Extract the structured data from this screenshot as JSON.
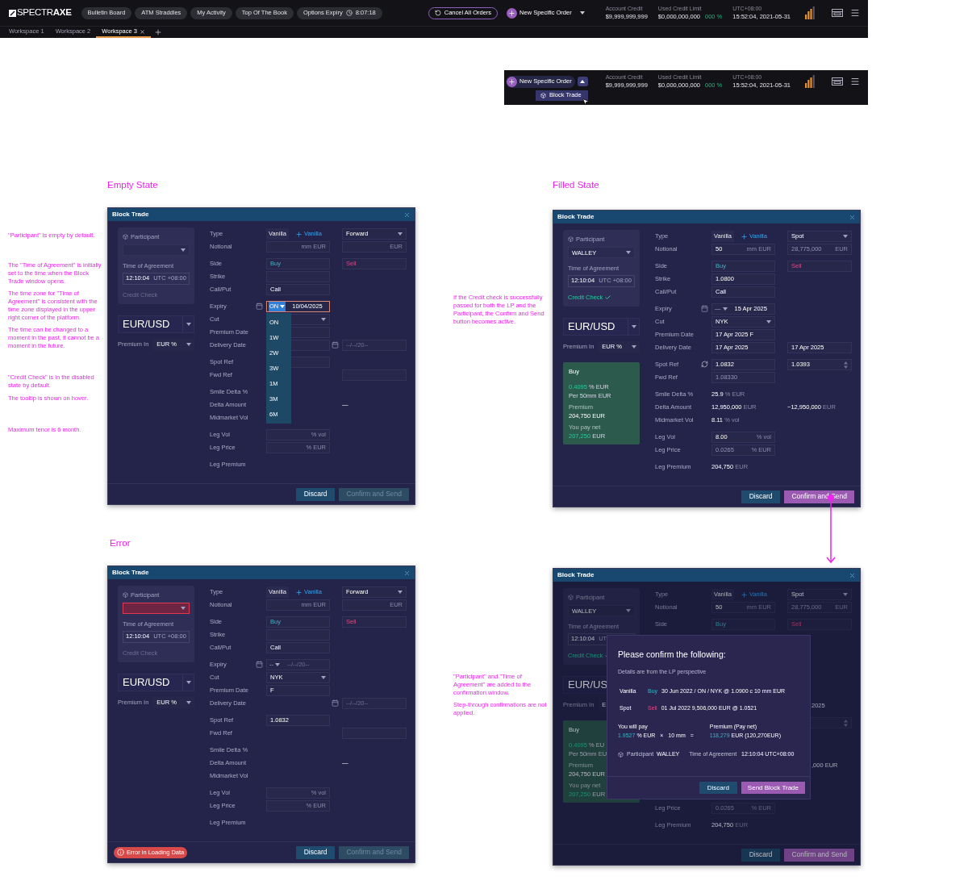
{
  "topbar": {
    "logo": "SPECTR**AXE**",
    "pills": [
      {
        "label": "Bulletin Board"
      },
      {
        "label": "ATM Straddles"
      },
      {
        "label": "My Activity"
      },
      {
        "label": "Top Of The Book"
      },
      {
        "label": "Options Expiry",
        "timer": "8:07:18"
      }
    ],
    "cancel": "Cancel All Orders",
    "order": {
      "label": "New Specific Order",
      "expanded": false
    },
    "credit": [
      {
        "label": "Account Credit",
        "value": "$9,999,999,999"
      },
      {
        "label": "Used Credit Limit",
        "value": "$0,000,000,000",
        "percent": "000 %"
      },
      {
        "label": "UTC+08:00",
        "value": "15:52:04, 2021-05-31"
      }
    ],
    "tabs": [
      {
        "label": "Workspace 1",
        "selected": false
      },
      {
        "label": "Workspace 2",
        "selected": false
      },
      {
        "label": "Workspace 3",
        "selected": true
      }
    ]
  },
  "menu_preview": {
    "order": {
      "label": "New Specific Order",
      "expanded": true,
      "items": [
        {
          "label": "Block Trade"
        }
      ]
    },
    "credit": [
      {
        "label": "Account Credit",
        "value": "$9,999,999,999"
      },
      {
        "label": "Used Credit Limit",
        "value": "$0,000,000,000",
        "percent": "000 %"
      },
      {
        "label": "UTC+08:00",
        "value": "15:52:04, 2021-05-31"
      }
    ]
  },
  "notes": {
    "empty": [
      "\"Participant\" is empty by default.",
      "The \"Time of Agreement\" is initially set to the time when the Block Trade window opens.",
      "The time zone for \"Time of Agreement\" is consistent with the time zone displayed in the upper right corner of the platform.",
      "The time can be changed to a moment in the past, it cannot be a moment in the future.",
      "\"Credit Check\" is in the disabled state by default.",
      "The tooltip is shown on hover.",
      "Maximum tenor is 6 month."
    ],
    "filled": [
      "If the Credit check is successfully passed for both the LP and the Participant, the Confirm and Send button becomes active."
    ],
    "confirm": [
      "\"Participant\" and \"Time of Agreement\" are added to the confirmation window.",
      "Step-through confirmations are not applied."
    ]
  },
  "sections": [
    {
      "heading": "Empty State",
      "window": {
        "title": "Block Trade",
        "participant": {
          "label": "Participant",
          "error": false
        },
        "agreement": {
          "label": "Time of Agreement",
          "time": "12:10:04",
          "zone": "UTC +08:00"
        },
        "credit_check": {
          "label": "Credit Check",
          "passed": false
        },
        "pair": "EUR/USD",
        "premium_in": {
          "label": "Premium In",
          "value": "EUR %"
        },
        "groups": [
          [
            {
              "kind": "row",
              "label": "Type",
              "near": {
                "kind": "type",
                "value": "Vanilla",
                "add": "Vanilla"
              },
              "far": {
                "kind": "select",
                "value": "Forward"
              }
            },
            {
              "kind": "row",
              "label": "Notional",
              "near": {
                "kind": "field",
                "unit": "mm EUR"
              },
              "far": {
                "kind": "field",
                "unit": "EUR"
              }
            }
          ],
          [
            {
              "kind": "row",
              "label": "Side",
              "near": {
                "kind": "buy",
                "value": "Buy"
              },
              "far": {
                "kind": "sell",
                "value": "Sell"
              }
            },
            {
              "kind": "row",
              "label": "Strike",
              "near": {
                "kind": "field"
              }
            },
            {
              "kind": "row",
              "label": "Call/Put",
              "near": {
                "kind": "field",
                "value": "Call"
              }
            }
          ],
          [
            {
              "kind": "row",
              "label": "Expiry",
              "near": {
                "kind": "expiry",
                "tenor": "ON",
                "date": "10/04/2025",
                "open": true,
                "options": [
                  "ON",
                  "1W",
                  "2W",
                  "3W",
                  "1M",
                  "3M",
                  "6M"
                ]
              }
            },
            {
              "kind": "row",
              "label": "Cut",
              "near": {
                "kind": "select"
              }
            },
            {
              "kind": "row",
              "label": "Premium Date",
              "near": {
                "kind": "field"
              }
            },
            {
              "kind": "row",
              "label": "Delivery Date",
              "near": {
                "kind": "field"
              },
              "far": {
                "kind": "datefield",
                "placeholder": "--/--/20--"
              }
            }
          ],
          [
            {
              "kind": "row",
              "label": "Spot Ref",
              "near": {
                "kind": "field"
              }
            },
            {
              "kind": "row",
              "label": "Fwd Ref",
              "far": {
                "kind": "field"
              }
            }
          ],
          [
            {
              "kind": "row",
              "label": "Smile Delta %"
            },
            {
              "kind": "row",
              "label": "Delta Amount",
              "far": {
                "kind": "text",
                "value": "—"
              }
            },
            {
              "kind": "row",
              "label": "Midmarket Vol"
            }
          ],
          [
            {
              "kind": "row",
              "label": "Leg Vol",
              "near": {
                "kind": "field",
                "unit": "% vol"
              }
            },
            {
              "kind": "row",
              "label": "Leg Price",
              "near": {
                "kind": "field",
                "unit": "% EUR"
              }
            }
          ],
          [
            {
              "kind": "row",
              "label": "Leg Premium"
            }
          ]
        ],
        "footer": {
          "discard": "Discard",
          "confirm": "Confirm and Send",
          "confirm_enabled": false
        }
      }
    },
    {
      "heading": "Filled State",
      "window": {
        "title": "Block Trade",
        "participant": {
          "label": "Participant",
          "value": "WALLEY",
          "error": false
        },
        "agreement": {
          "label": "Time of Agreement",
          "time": "12:10:04",
          "zone": "UTC +08:00"
        },
        "credit_check": {
          "label": "Credit Check",
          "passed": true
        },
        "pair": "EUR/USD",
        "premium_in": {
          "label": "Premium In",
          "value": "EUR %"
        },
        "summary": {
          "title": "Buy",
          "rate": "0.4095",
          "rate_unit": "% EUR",
          "per": "Per 50mm EUR",
          "premium_label": "Premium",
          "premium": "204,750 EUR",
          "net_label": "You pay net",
          "net": "207,250",
          "net_unit": "EUR"
        },
        "groups": [
          [
            {
              "kind": "row",
              "label": "Type",
              "near": {
                "kind": "type",
                "value": "Vanilla",
                "add": "Vanilla"
              },
              "far": {
                "kind": "select",
                "value": "Spot"
              }
            },
            {
              "kind": "row",
              "label": "Notional",
              "near": {
                "kind": "field",
                "value": "50",
                "unit": "mm EUR",
                "muted": false
              },
              "far": {
                "kind": "field",
                "value": "28,775,000",
                "unit": "EUR",
                "muted": true
              }
            }
          ],
          [
            {
              "kind": "row",
              "label": "Side",
              "near": {
                "kind": "buy",
                "value": "Buy"
              },
              "far": {
                "kind": "sell",
                "value": "Sell"
              }
            },
            {
              "kind": "row",
              "label": "Strike",
              "near": {
                "kind": "field",
                "value": "1.0800"
              }
            },
            {
              "kind": "row",
              "label": "Call/Put",
              "near": {
                "kind": "field",
                "value": "Call"
              }
            }
          ],
          [
            {
              "kind": "row",
              "label": "Expiry",
              "near": {
                "kind": "expiry",
                "tenor": "—",
                "date": "15 Apr 2025",
                "open": false
              }
            },
            {
              "kind": "row",
              "label": "Cut",
              "near": {
                "kind": "select",
                "value": "NYK"
              }
            },
            {
              "kind": "row",
              "label": "Premium Date",
              "near": {
                "kind": "field",
                "value": "17 Apr 2025 F"
              }
            },
            {
              "kind": "row",
              "label": "Delivery Date",
              "near": {
                "kind": "field",
                "value": "17 Apr 2025"
              },
              "far": {
                "kind": "field",
                "value": "17 Apr 2025"
              }
            }
          ],
          [
            {
              "kind": "row",
              "label": "Spot Ref",
              "near": {
                "kind": "reffield",
                "value": "1.0832"
              },
              "far": {
                "kind": "spin",
                "value": "1.0393"
              }
            },
            {
              "kind": "row",
              "label": "Fwd Ref",
              "near": {
                "kind": "field",
                "value": "1.08330",
                "muted": true
              }
            }
          ],
          [
            {
              "kind": "row",
              "label": "Smile Delta %",
              "near": {
                "kind": "text",
                "value": "25.9",
                "unit": "% EUR"
              }
            },
            {
              "kind": "row",
              "label": "Delta Amount",
              "near": {
                "kind": "text",
                "value": "12,950,000",
                "unit": "EUR"
              },
              "far": {
                "kind": "text",
                "value": "−12,950,000",
                "unit": "EUR"
              }
            },
            {
              "kind": "row",
              "label": "Midmarket Vol",
              "near": {
                "kind": "text",
                "value": "8.11",
                "unit": "% vol"
              }
            }
          ],
          [
            {
              "kind": "row",
              "label": "Leg Vol",
              "near": {
                "kind": "field",
                "value": "8.00",
                "unit": "% vol",
                "muted": false
              }
            },
            {
              "kind": "row",
              "label": "Leg Price",
              "near": {
                "kind": "field",
                "value": "0.0265",
                "unit": "% EUR",
                "muted": true
              }
            }
          ],
          [
            {
              "kind": "row",
              "label": "Leg Premium",
              "near": {
                "kind": "text",
                "value": "204,750",
                "unit": "EUR"
              }
            }
          ]
        ],
        "footer": {
          "discard": "Discard",
          "confirm": "Confirm and Send",
          "confirm_enabled": true
        }
      }
    },
    {
      "heading": "Error",
      "window": {
        "title": "Block Trade",
        "participant": {
          "label": "Participant",
          "error": true
        },
        "agreement": {
          "label": "Time of Agreement",
          "time": "12:10:04",
          "zone": "UTC +08:00"
        },
        "credit_check": {
          "label": "Credit Check",
          "passed": false
        },
        "pair": "EUR/USD",
        "premium_in": {
          "label": "Premium In",
          "value": "EUR %"
        },
        "groups": [
          [
            {
              "kind": "row",
              "label": "Type",
              "near": {
                "kind": "type",
                "value": "Vanilla",
                "add": "Vanilla"
              },
              "far": {
                "kind": "select",
                "value": "Forward"
              }
            },
            {
              "kind": "row",
              "label": "Notional",
              "near": {
                "kind": "field",
                "unit": "mm EUR"
              },
              "far": {
                "kind": "field",
                "unit": "EUR"
              }
            }
          ],
          [
            {
              "kind": "row",
              "label": "Side",
              "near": {
                "kind": "buy",
                "value": "Buy"
              },
              "far": {
                "kind": "sell",
                "value": "Sell"
              }
            },
            {
              "kind": "row",
              "label": "Strike",
              "near": {
                "kind": "field"
              }
            },
            {
              "kind": "row",
              "label": "Call/Put",
              "near": {
                "kind": "field",
                "value": "Call"
              }
            }
          ],
          [
            {
              "kind": "row",
              "label": "Expiry",
              "near": {
                "kind": "expiry",
                "tenor": "--",
                "placeholder": "--/--/20--",
                "open": false
              }
            },
            {
              "kind": "row",
              "label": "Cut",
              "near": {
                "kind": "select",
                "value": "NYK"
              }
            },
            {
              "kind": "row",
              "label": "Premium Date",
              "near": {
                "kind": "field",
                "value": "F"
              }
            },
            {
              "kind": "row",
              "label": "Delivery Date",
              "far": {
                "kind": "datefield",
                "placeholder": "--/--/20--"
              }
            }
          ],
          [
            {
              "kind": "row",
              "label": "Spot Ref",
              "near": {
                "kind": "field",
                "value": "1.0832"
              }
            },
            {
              "kind": "row",
              "label": "Fwd Ref",
              "far": {
                "kind": "field"
              }
            }
          ],
          [
            {
              "kind": "row",
              "label": "Smile Delta %"
            },
            {
              "kind": "row",
              "label": "Delta Amount",
              "far": {
                "kind": "text",
                "value": "—"
              }
            },
            {
              "kind": "row",
              "label": "Midmarket Vol"
            }
          ],
          [
            {
              "kind": "row",
              "label": "Leg Vol",
              "near": {
                "kind": "field",
                "unit": "% vol"
              }
            },
            {
              "kind": "row",
              "label": "Leg Price",
              "near": {
                "kind": "field",
                "unit": "% EUR"
              }
            }
          ],
          [
            {
              "kind": "row",
              "label": "Leg Premium"
            }
          ]
        ],
        "footer": {
          "error": "Error in Loading Data",
          "discard": "Discard",
          "confirm": "Confirm and Send",
          "confirm_enabled": false
        }
      }
    },
    {
      "window": {
        "title": "Block Trade",
        "participant": {
          "label": "Participant",
          "value": "WALLEY",
          "error": false
        },
        "agreement": {
          "label": "Time of Agreement",
          "time": "12:10:04",
          "zone": "UT"
        },
        "credit_check": {
          "label": "Credit Check",
          "passed": true
        },
        "pair": "EUR/US",
        "premium_in": {
          "label": "Premium In",
          "value": "E"
        },
        "summary": {
          "title": "Buy",
          "rate": "0.4095",
          "rate_unit": "% EU",
          "per": "Per 50mm EU",
          "premium_label": "Premium",
          "premium": "204,750 EUR",
          "net_label": "You pay net",
          "net": "207,250",
          "net_unit": "EUR"
        },
        "groups": [
          [
            {
              "kind": "row",
              "label": "Type",
              "near": {
                "kind": "type",
                "value": "Vanilla",
                "add": "Vanilla"
              },
              "far": {
                "kind": "select",
                "value": "Spot"
              }
            },
            {
              "kind": "row",
              "label": "Notional",
              "near": {
                "kind": "field",
                "value": "50",
                "unit": "mm EUR",
                "muted": false
              },
              "far": {
                "kind": "field",
                "value": "28,775,000",
                "unit": "EUR",
                "muted": true
              }
            }
          ],
          [
            {
              "kind": "row",
              "label": "Side",
              "near": {
                "kind": "buy",
                "value": "Buy"
              },
              "far": {
                "kind": "sell",
                "value": "Sell"
              }
            },
            {
              "kind": "covered"
            },
            {
              "kind": "covered"
            }
          ],
          [
            {
              "kind": "covered"
            },
            {
              "kind": "covered"
            },
            {
              "kind": "covered"
            },
            {
              "kind": "row",
              "far": {
                "kind": "tail",
                "value": "2025"
              }
            }
          ],
          [
            {
              "kind": "row",
              "far": {
                "kind": "spin"
              }
            },
            {
              "kind": "covered"
            }
          ],
          [
            {
              "kind": "covered"
            },
            {
              "kind": "row",
              "far": {
                "kind": "tail",
                "value": ",000 EUR"
              }
            },
            {
              "kind": "covered"
            }
          ],
          [
            {
              "kind": "covered"
            },
            {
              "kind": "row",
              "label": "Leg Price",
              "near": {
                "kind": "field",
                "value": "0.0265",
                "unit": "% EUR",
                "muted": true
              }
            }
          ],
          [
            {
              "kind": "row",
              "label": "Leg Premium",
              "near": {
                "kind": "text",
                "value": "204,750",
                "unit": "EUR"
              }
            }
          ]
        ],
        "footer": {
          "discard": "Discard",
          "confirm": "Confirm and Send",
          "confirm_enabled": true
        },
        "confirm_dialog": {
          "title": "Please confirm the following:",
          "subtitle": "Details are from the LP perspective",
          "legs": [
            {
              "kind": "buy",
              "name": "Vanilla",
              "side": "Buy",
              "details": "30 Jun 2022 / ON / NYK  @ 1.0900 c 10 mm EUR"
            },
            {
              "kind": "sell",
              "name": "Spot",
              "side": "Sell",
              "details": "01 Jul 2022 9,506,000 EUR @ 1.0521"
            }
          ],
          "pay": {
            "label": "You will pay",
            "rate": "1.9527",
            "unit": "% EUR",
            "times": "×",
            "size": "10 mm",
            "equals": "="
          },
          "premium": {
            "label": "Premium (Pay net)",
            "amount": "118,279",
            "detail": "EUR (120,270EUR)"
          },
          "participant": {
            "label": "Participant",
            "value": "WALLEY"
          },
          "agreement": {
            "label": "Time of Agreement",
            "value": "12:10:04 UTC+08:00"
          },
          "discard": "Discard",
          "send": "Send Block Trade"
        }
      }
    }
  ]
}
